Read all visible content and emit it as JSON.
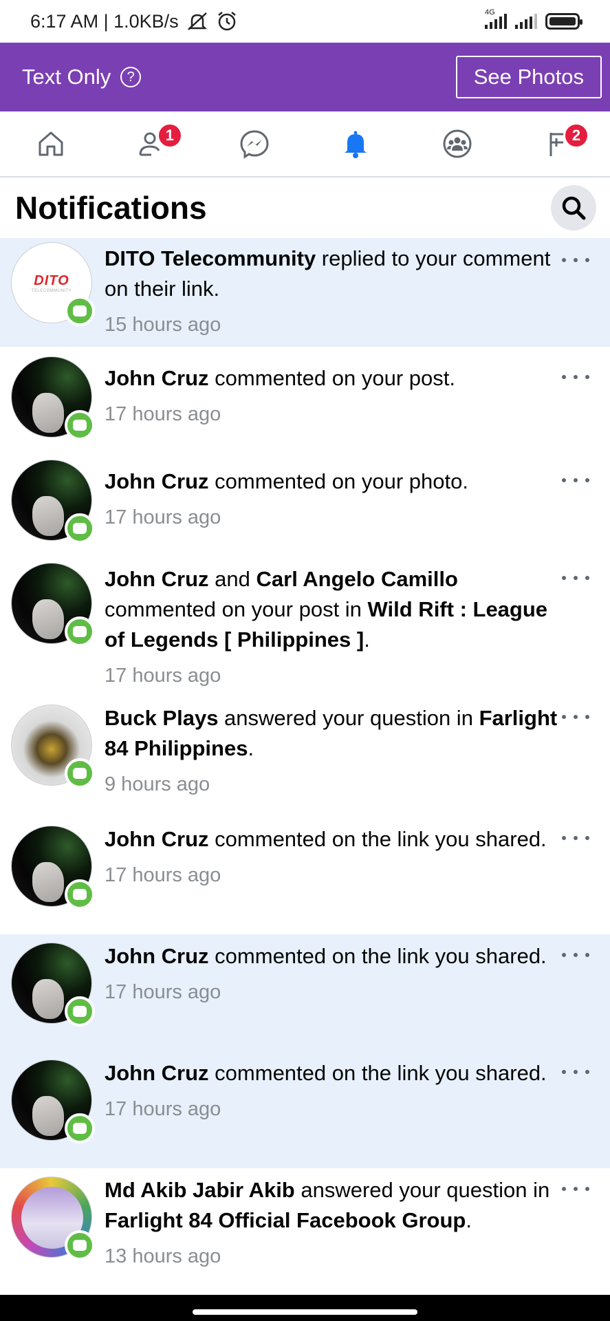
{
  "status_bar": {
    "time_speed": "6:17 AM | 1.0KB/s",
    "network_label": "4G"
  },
  "banner": {
    "title": "Text Only",
    "see_photos_label": "See Photos",
    "color": "#7b3fb4"
  },
  "tabs": [
    {
      "name": "home-icon",
      "badge": ""
    },
    {
      "name": "friends-icon",
      "badge": "1"
    },
    {
      "name": "messenger-icon",
      "badge": ""
    },
    {
      "name": "notifications-bell-icon",
      "badge": "",
      "active": true
    },
    {
      "name": "groups-icon",
      "badge": ""
    },
    {
      "name": "menu-flag-icon",
      "badge": "2"
    }
  ],
  "header": {
    "title": "Notifications"
  },
  "notifications": [
    {
      "unread": true,
      "avatar": "dito-logo",
      "avatar_text": "DITO",
      "actor": "DITO Telecommunity",
      "text_1": " replied to your comment on their link.",
      "time": "15 hours ago"
    },
    {
      "unread": false,
      "actor": "John Cruz",
      "text_1": " commented on your post.",
      "time": "17 hours ago"
    },
    {
      "unread": false,
      "actor": "John Cruz",
      "text_1": " commented on your photo.",
      "time": "17 hours ago"
    },
    {
      "unread": false,
      "actor": "John Cruz",
      "text_1": " and ",
      "actor_2": "Carl Angelo Camillo",
      "text_2": " commented on your post in ",
      "group": "Wild Rift : League of Legends [ Philippines ]",
      "text_3": ".",
      "time": "17 hours ago"
    },
    {
      "unread": false,
      "actor": "Buck Plays",
      "text_1": " answered your question in ",
      "group": "Farlight 84 Philippines",
      "text_3": ".",
      "time": "9 hours ago"
    },
    {
      "unread": false,
      "actor": "John Cruz",
      "text_1": " commented on the link you shared.",
      "time": "17 hours ago"
    },
    {
      "unread": true,
      "actor": "John Cruz",
      "text_1": " commented on the link you shared.",
      "time": "17 hours ago"
    },
    {
      "unread": true,
      "actor": "John Cruz",
      "text_1": " commented on the link you shared.",
      "time": "17 hours ago"
    },
    {
      "unread": false,
      "actor": "Md Akib Jabir Akib",
      "text_1": " answered your question in ",
      "group": "Farlight 84 Official Facebook Group",
      "text_3": ".",
      "time": "13 hours ago"
    }
  ],
  "colors": {
    "unread_bg": "#e7f0fb",
    "badge_red": "#e41e3f",
    "active_blue": "#1877f2",
    "comment_green": "#5fbd45"
  }
}
